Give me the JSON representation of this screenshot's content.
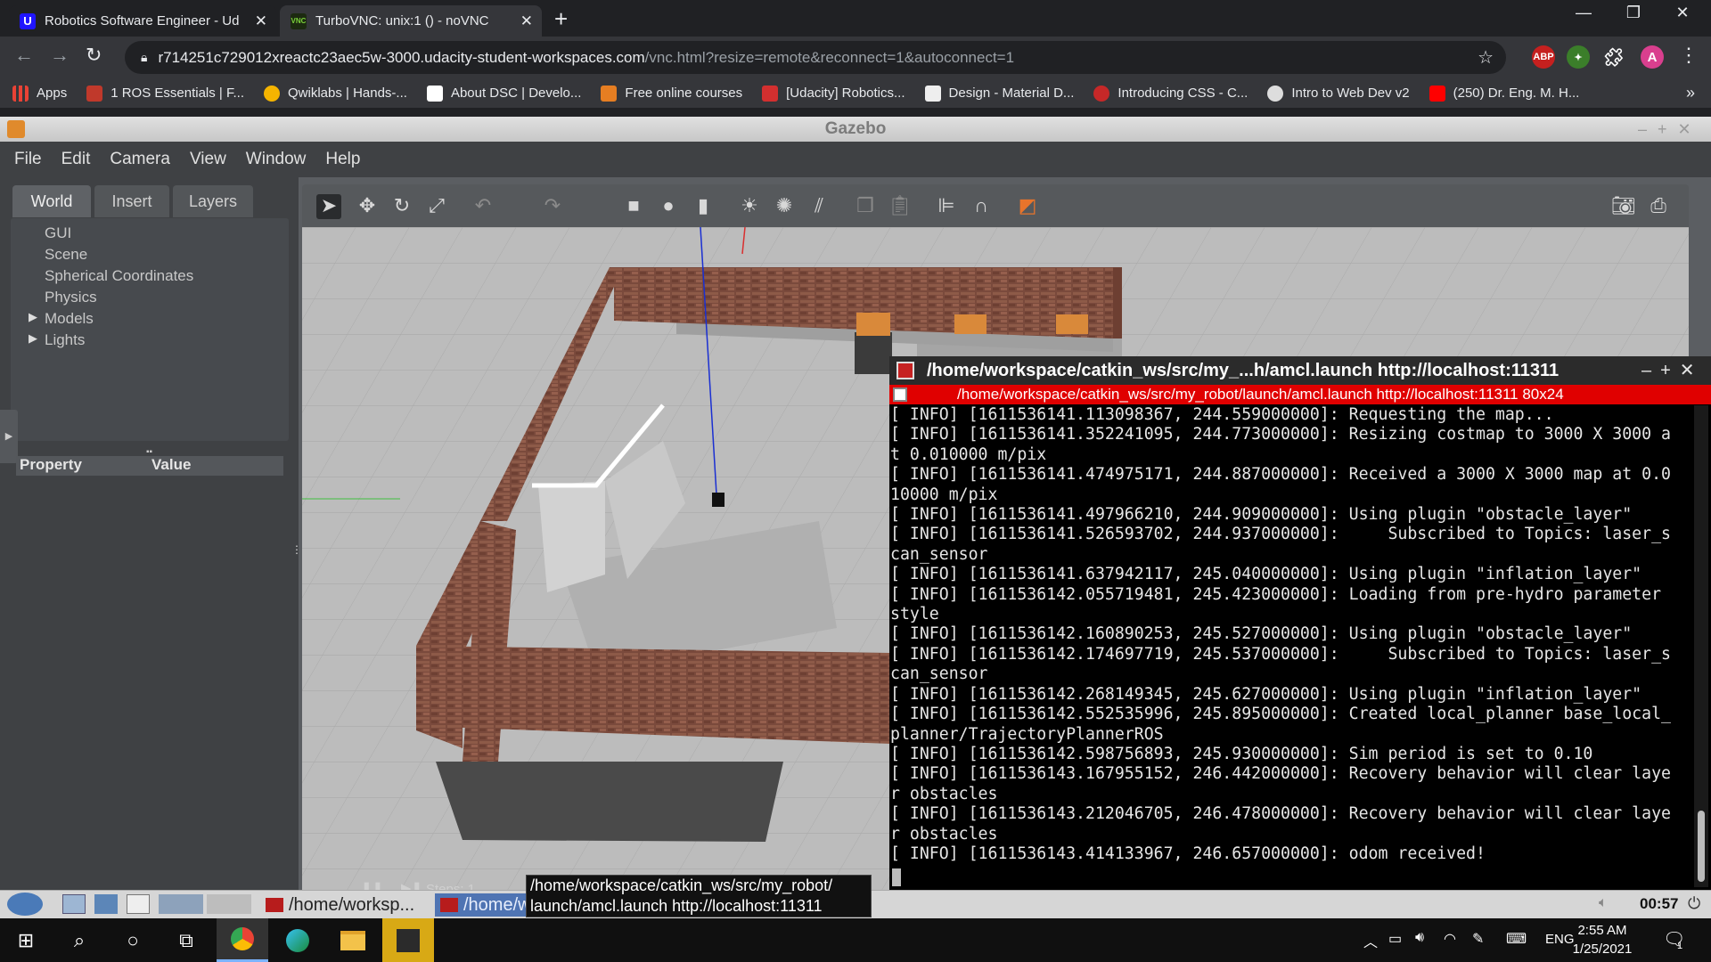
{
  "browser": {
    "tabs": [
      {
        "label": "Robotics Software Engineer - Ud",
        "fav_color": "#2015ff"
      },
      {
        "label": "TurboVNC: unix:1 () - noVNC",
        "fav_color": "#3d8f1b"
      }
    ],
    "url_host": "r714251c729012xreactc23aec5w-3000.udacity-student-workspaces.com",
    "url_rest": "/vnc.html?resize=remote&reconnect=1&autoconnect=1",
    "profile_initial": "A",
    "abp_label": "ABP",
    "bookmarks": [
      {
        "label": "Apps",
        "color": "#e94235"
      },
      {
        "label": "1 ROS Essentials | F...",
        "color": "#c0392b"
      },
      {
        "label": "Qwiklabs | Hands-...",
        "color": "#f5b400"
      },
      {
        "label": "About DSC | Develo...",
        "color": "#ffffff"
      },
      {
        "label": "Free online courses",
        "color": "#e67e22"
      },
      {
        "label": "[Udacity] Robotics...",
        "color": "#d32f2f"
      },
      {
        "label": "Design - Material D...",
        "color": "#eeeeee"
      },
      {
        "label": "Introducing CSS - C...",
        "color": "#c62828"
      },
      {
        "label": "Intro to Web Dev v2",
        "color": "#dddddd"
      },
      {
        "label": "(250) Dr. Eng. M. H...",
        "color": "#ff0000"
      }
    ],
    "more_bookmarks": "»"
  },
  "gazebo": {
    "title": "Gazebo",
    "menu": [
      "File",
      "Edit",
      "Camera",
      "View",
      "Window",
      "Help"
    ],
    "panel_tabs": [
      "World",
      "Insert",
      "Layers"
    ],
    "tree": [
      "GUI",
      "Scene",
      "Spherical Coordinates",
      "Physics",
      "Models",
      "Lights"
    ],
    "prop_headers": {
      "property": "Property",
      "value": "Value"
    },
    "steps_label": "Steps: 1",
    "sim_time": "00:57"
  },
  "terminal": {
    "title": "/home/workspace/catkin_ws/src/my_...h/amcl.launch http://localhost:11311",
    "subtitle": "/home/workspace/catkin_ws/src/my_robot/launch/amcl.launch http://localhost:11311 80x24",
    "lines": [
      "[ INFO] [1611536141.113098367, 244.559000000]: Requesting the map...",
      "[ INFO] [1611536141.352241095, 244.773000000]: Resizing costmap to 3000 X 3000 a",
      "t 0.010000 m/pix",
      "[ INFO] [1611536141.474975171, 244.887000000]: Received a 3000 X 3000 map at 0.0",
      "10000 m/pix",
      "[ INFO] [1611536141.497966210, 244.909000000]: Using plugin \"obstacle_layer\"",
      "[ INFO] [1611536141.526593702, 244.937000000]:     Subscribed to Topics: laser_s",
      "can_sensor",
      "[ INFO] [1611536141.637942117, 245.040000000]: Using plugin \"inflation_layer\"",
      "[ INFO] [1611536142.055719481, 245.423000000]: Loading from pre-hydro parameter",
      "style",
      "[ INFO] [1611536142.160890253, 245.527000000]: Using plugin \"obstacle_layer\"",
      "[ INFO] [1611536142.174697719, 245.537000000]:     Subscribed to Topics: laser_s",
      "can_sensor",
      "[ INFO] [1611536142.268149345, 245.627000000]: Using plugin \"inflation_layer\"",
      "[ INFO] [1611536142.552535996, 245.895000000]: Created local_planner base_local_",
      "planner/TrajectoryPlannerROS",
      "[ INFO] [1611536142.598756893, 245.930000000]: Sim period is set to 0.10",
      "[ INFO] [1611536143.167955152, 246.442000000]: Recovery behavior will clear laye",
      "r obstacles",
      "[ INFO] [1611536143.212046705, 246.478000000]: Recovery behavior will clear laye",
      "r obstacles",
      "[ INFO] [1611536143.414133967, 246.657000000]: odom received!"
    ]
  },
  "vnc_taskbar": {
    "task1": "/home/worksp...",
    "task2": "/home/w",
    "tooltip_line1": "/home/workspace/catkin_ws/src/my_robot/",
    "tooltip_line2": "launch/amcl.launch http://localhost:11311",
    "time": "00:57"
  },
  "windows": {
    "lang": "ENG",
    "time": "2:55 AM",
    "date": "1/25/2021",
    "notif_count": "1"
  }
}
